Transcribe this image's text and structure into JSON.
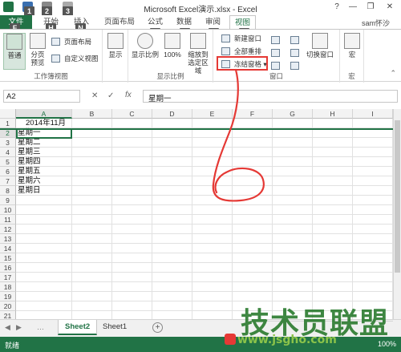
{
  "window": {
    "title": "Microsoft Excel演示.xlsx - Excel",
    "help": "?",
    "minimize": "—",
    "restore": "❐",
    "close": "✕",
    "user": "sam怀沙"
  },
  "keytips": {
    "qat1": "1",
    "qat2": "2",
    "qat3": "3",
    "file": "F",
    "home": "H",
    "insert": "N",
    "layout": "P",
    "formula": "M",
    "data": "A",
    "review": "R",
    "view": "W"
  },
  "tabs": {
    "file": "文件",
    "home": "开始",
    "insert": "插入",
    "page_layout": "页面布局",
    "formulas": "公式",
    "data": "数据",
    "review": "审阅",
    "view": "视图"
  },
  "ribbon": {
    "workbook_views": {
      "label": "工作簿视图",
      "normal": "普通",
      "page_break": "分页预览",
      "page_layout": "页面布局",
      "custom_views": "自定义视图"
    },
    "show": {
      "label": "显示",
      "show": "显示"
    },
    "zoom": {
      "label": "显示比例",
      "zoom": "显示比例",
      "hundred": "100%",
      "zoom_to_selection": "缩放到选定区域"
    },
    "window": {
      "label": "窗口",
      "new_window": "新建窗口",
      "arrange_all": "全部重排",
      "freeze_panes": "冻结窗格",
      "switch_windows": "切换窗口"
    },
    "macros": {
      "label": "宏",
      "macros": "宏"
    }
  },
  "formula_bar": {
    "name_box": "A2",
    "cancel": "✕",
    "enter": "✓",
    "fx": "fx",
    "content": "星期一"
  },
  "grid": {
    "columns": [
      "A",
      "B",
      "C",
      "D",
      "E",
      "F",
      "G",
      "H",
      "I"
    ],
    "rows": [
      "1",
      "2",
      "3",
      "4",
      "5",
      "6",
      "7",
      "8",
      "9",
      "10",
      "11",
      "12",
      "13",
      "14",
      "15",
      "16",
      "17",
      "18",
      "19",
      "20",
      "21"
    ],
    "cells": [
      "2014年11月",
      "星期一",
      "星期二",
      "星期三",
      "星期四",
      "星期五",
      "星期六",
      "星期日"
    ]
  },
  "sheets": {
    "active": "Sheet2",
    "other": "Sheet1",
    "add": "+"
  },
  "status": {
    "ready": "就绪",
    "zoom": "100%"
  },
  "watermark": {
    "brand": "技术员联盟",
    "url": "www.jsgho.com"
  }
}
